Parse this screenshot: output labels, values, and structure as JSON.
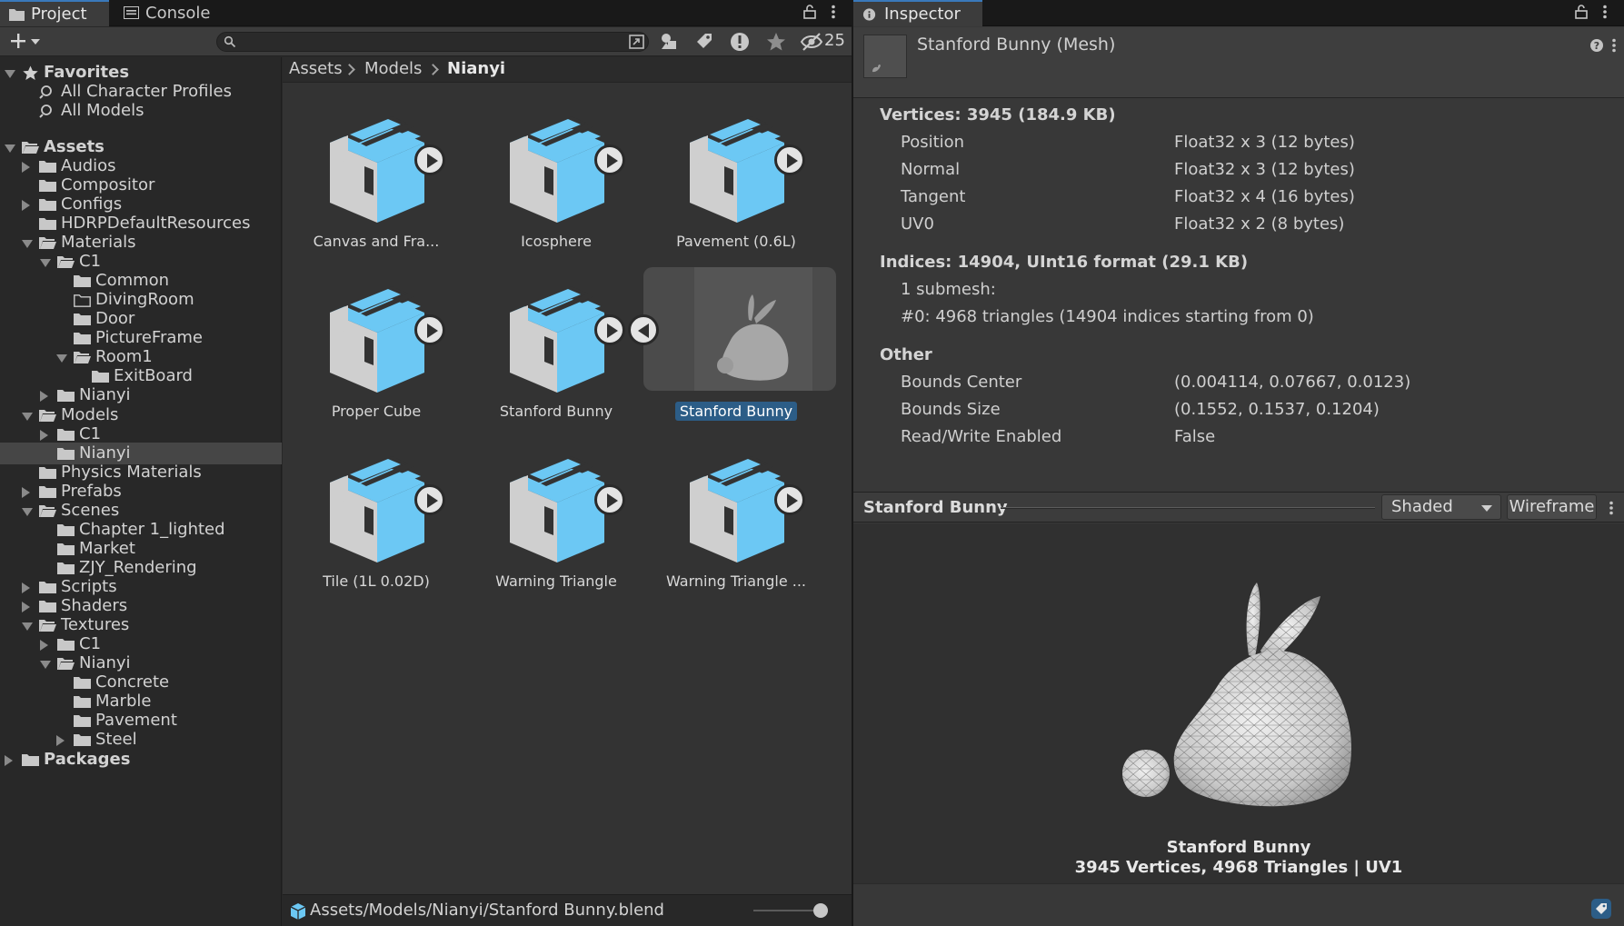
{
  "project_tabs": [
    {
      "label": "Project",
      "icon": "folder-icon"
    },
    {
      "label": "Console",
      "icon": "console-icon"
    }
  ],
  "search": {
    "placeholder": "",
    "value": ""
  },
  "toolbar": {
    "hidden_packages_count": "25"
  },
  "tree": [
    {
      "label": "Favorites",
      "depth": 0,
      "arrow": "open",
      "icon": "star",
      "bold": true
    },
    {
      "label": "All Character Profiles",
      "depth": 1,
      "arrow": "none",
      "icon": "search"
    },
    {
      "label": "All Models",
      "depth": 1,
      "arrow": "none",
      "icon": "search"
    },
    {
      "label": "Assets",
      "depth": 0,
      "arrow": "open",
      "icon": "folder-open",
      "bold": true
    },
    {
      "label": "Audios",
      "depth": 1,
      "arrow": "closed",
      "icon": "folder"
    },
    {
      "label": "Compositor",
      "depth": 1,
      "arrow": "none",
      "icon": "folder"
    },
    {
      "label": "Configs",
      "depth": 1,
      "arrow": "closed",
      "icon": "folder"
    },
    {
      "label": "HDRPDefaultResources",
      "depth": 1,
      "arrow": "none",
      "icon": "folder"
    },
    {
      "label": "Materials",
      "depth": 1,
      "arrow": "open",
      "icon": "folder-open"
    },
    {
      "label": "C1",
      "depth": 2,
      "arrow": "open",
      "icon": "folder-open"
    },
    {
      "label": "Common",
      "depth": 3,
      "arrow": "none",
      "icon": "folder"
    },
    {
      "label": "DivingRoom",
      "depth": 3,
      "arrow": "none",
      "icon": "folder-empty"
    },
    {
      "label": "Door",
      "depth": 3,
      "arrow": "none",
      "icon": "folder"
    },
    {
      "label": "PictureFrame",
      "depth": 3,
      "arrow": "none",
      "icon": "folder"
    },
    {
      "label": "Room1",
      "depth": 3,
      "arrow": "open",
      "icon": "folder-open"
    },
    {
      "label": "ExitBoard",
      "depth": 4,
      "arrow": "none",
      "icon": "folder"
    },
    {
      "label": "Nianyi",
      "depth": 2,
      "arrow": "closed",
      "icon": "folder"
    },
    {
      "label": "Models",
      "depth": 1,
      "arrow": "open",
      "icon": "folder-open"
    },
    {
      "label": "C1",
      "depth": 2,
      "arrow": "closed",
      "icon": "folder"
    },
    {
      "label": "Nianyi",
      "depth": 2,
      "arrow": "none",
      "icon": "folder",
      "selected": true
    },
    {
      "label": "Physics Materials",
      "depth": 1,
      "arrow": "none",
      "icon": "folder"
    },
    {
      "label": "Prefabs",
      "depth": 1,
      "arrow": "closed",
      "icon": "folder"
    },
    {
      "label": "Scenes",
      "depth": 1,
      "arrow": "open",
      "icon": "folder-open"
    },
    {
      "label": "Chapter 1_lighted",
      "depth": 2,
      "arrow": "none",
      "icon": "folder"
    },
    {
      "label": "Market",
      "depth": 2,
      "arrow": "none",
      "icon": "folder"
    },
    {
      "label": "ZJY_Rendering",
      "depth": 2,
      "arrow": "none",
      "icon": "folder"
    },
    {
      "label": "Scripts",
      "depth": 1,
      "arrow": "closed",
      "icon": "folder"
    },
    {
      "label": "Shaders",
      "depth": 1,
      "arrow": "closed",
      "icon": "folder"
    },
    {
      "label": "Textures",
      "depth": 1,
      "arrow": "open",
      "icon": "folder-open"
    },
    {
      "label": "C1",
      "depth": 2,
      "arrow": "closed",
      "icon": "folder"
    },
    {
      "label": "Nianyi",
      "depth": 2,
      "arrow": "open",
      "icon": "folder-open"
    },
    {
      "label": "Concrete",
      "depth": 3,
      "arrow": "none",
      "icon": "folder"
    },
    {
      "label": "Marble",
      "depth": 3,
      "arrow": "none",
      "icon": "folder"
    },
    {
      "label": "Pavement",
      "depth": 3,
      "arrow": "none",
      "icon": "folder"
    },
    {
      "label": "Steel",
      "depth": 3,
      "arrow": "closed",
      "icon": "folder"
    },
    {
      "label": "Packages",
      "depth": 0,
      "arrow": "closed",
      "icon": "folder",
      "bold": true
    }
  ],
  "breadcrumb": [
    "Assets",
    "Models",
    "Nianyi"
  ],
  "assets": [
    {
      "name": "Canvas and Fra...",
      "type": "model"
    },
    {
      "name": "Icosphere",
      "type": "model"
    },
    {
      "name": "Pavement (0.6L)",
      "type": "model"
    },
    {
      "name": "Proper Cube",
      "type": "model"
    },
    {
      "name": "Stanford Bunny",
      "type": "model"
    },
    {
      "name": "Stanford Bunny",
      "type": "mesh",
      "selected": true
    },
    {
      "name": "Tile (1L 0.02D)",
      "type": "model"
    },
    {
      "name": "Warning Triangle",
      "type": "model"
    },
    {
      "name": "Warning Triangle ...",
      "type": "model"
    }
  ],
  "status_path": "Assets/Models/Nianyi/Stanford Bunny.blend",
  "zoom_level": 0.85,
  "inspector": {
    "tab": "Inspector",
    "title": "Stanford Bunny (Mesh)",
    "vertices_header": "Vertices: 3945 (184.9 KB)",
    "vertex_attrs": [
      {
        "name": "Position",
        "value": "Float32 x 3 (12 bytes)"
      },
      {
        "name": "Normal",
        "value": "Float32 x 3 (12 bytes)"
      },
      {
        "name": "Tangent",
        "value": "Float32 x 4 (16 bytes)"
      },
      {
        "name": "UV0",
        "value": "Float32 x 2 (8 bytes)"
      }
    ],
    "indices_header": "Indices: 14904, UInt16 format (29.1 KB)",
    "submesh_count": "1 submesh:",
    "submesh_detail": "#0: 4968 triangles (14904 indices starting from 0)",
    "other_header": "Other",
    "other": [
      {
        "name": "Bounds Center",
        "value": "(0.004114, 0.07667, 0.0123)"
      },
      {
        "name": "Bounds Size",
        "value": "(0.1552, 0.1537, 0.1204)"
      },
      {
        "name": "Read/Write Enabled",
        "value": "False"
      }
    ]
  },
  "preview": {
    "title": "Stanford Bunny",
    "shading": "Shaded",
    "wireframe_label": "Wireframe",
    "caption_name": "Stanford Bunny",
    "caption_stats": "3945 Vertices, 4968 Triangles | UV1"
  },
  "colors": {
    "selection": "#2c5d87",
    "cube_blue": "#6cc8f4",
    "cube_grey": "#cfcfcf",
    "tab_accent": "#3a79bb"
  }
}
